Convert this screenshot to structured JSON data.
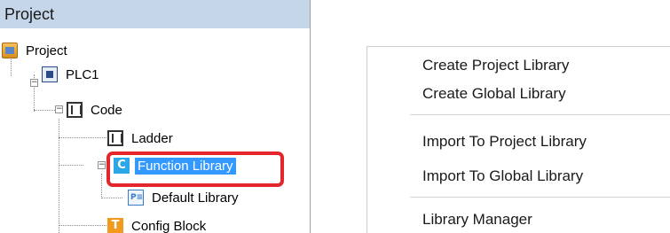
{
  "panel": {
    "title": "Project",
    "tree": [
      {
        "label": "Project",
        "icon": "project-folder-icon"
      },
      {
        "label": "PLC1",
        "icon": "plc-icon"
      },
      {
        "label": "Code",
        "icon": "code-icon"
      },
      {
        "label": "Ladder",
        "icon": "ladder-icon"
      },
      {
        "label": "Function Library",
        "icon": "function-library-icon",
        "icon_letter": "C",
        "selected": true
      },
      {
        "label": "Default Library",
        "icon": "library-icon",
        "icon_letter": "P≡"
      },
      {
        "label": "Config Block",
        "icon": "config-block-icon",
        "icon_letter": "T"
      }
    ],
    "expanders": {
      "plc1": "−",
      "code": "−",
      "function_library": "−"
    }
  },
  "context_menu": {
    "items": [
      "Create Project Library",
      "Create Global Library",
      "Import To Project Library",
      "Import To Global Library",
      "Library Manager"
    ]
  },
  "colors": {
    "header_bg": "#c5d5ea",
    "selection": "#3399ff",
    "highlight_box": "#e3262b"
  }
}
